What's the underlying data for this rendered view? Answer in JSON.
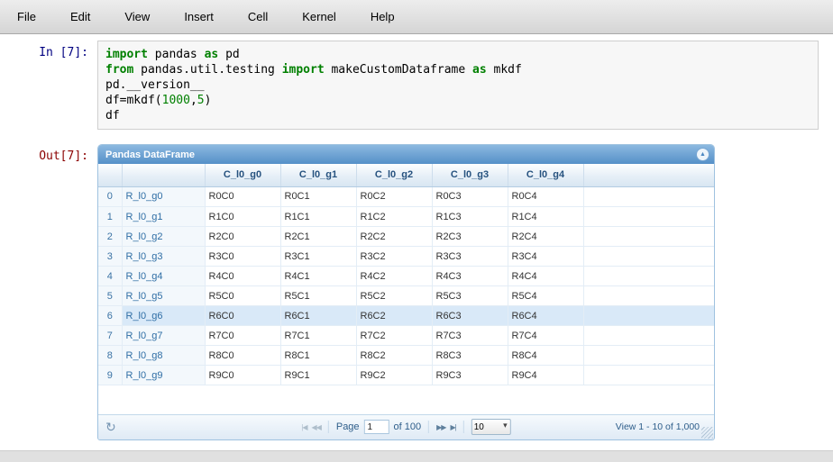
{
  "menu": {
    "items": [
      "File",
      "Edit",
      "View",
      "Insert",
      "Cell",
      "Kernel",
      "Help"
    ]
  },
  "icons": {
    "refresh": "↻",
    "collapse": "▲",
    "nav_first": "|◀",
    "nav_prev": "◀◀",
    "nav_next": "▶▶",
    "nav_last": "▶|"
  },
  "input_cell": {
    "prompt": "In [7]:",
    "code_lines": [
      [
        {
          "t": "kw",
          "v": "import"
        },
        {
          "t": "tx",
          "v": " pandas "
        },
        {
          "t": "kw",
          "v": "as"
        },
        {
          "t": "tx",
          "v": " pd"
        }
      ],
      [
        {
          "t": "kw",
          "v": "from"
        },
        {
          "t": "tx",
          "v": " pandas.util.testing "
        },
        {
          "t": "kw",
          "v": "import"
        },
        {
          "t": "tx",
          "v": " makeCustomDataframe "
        },
        {
          "t": "kw",
          "v": "as"
        },
        {
          "t": "tx",
          "v": " mkdf"
        }
      ],
      [
        {
          "t": "tx",
          "v": "pd.__version__"
        }
      ],
      [
        {
          "t": "tx",
          "v": "df=mkdf("
        },
        {
          "t": "num",
          "v": "1000"
        },
        {
          "t": "tx",
          "v": ","
        },
        {
          "t": "num",
          "v": "5"
        },
        {
          "t": "tx",
          "v": ")"
        }
      ],
      [
        {
          "t": "tx",
          "v": "df"
        }
      ]
    ]
  },
  "output_cell": {
    "prompt": "Out[7]:",
    "widget": {
      "title": "Pandas DataFrame",
      "columns": [
        "C_l0_g0",
        "C_l0_g1",
        "C_l0_g2",
        "C_l0_g3",
        "C_l0_g4"
      ],
      "rows": [
        {
          "n": "0",
          "index": "R_l0_g0",
          "cells": [
            "R0C0",
            "R0C1",
            "R0C2",
            "R0C3",
            "R0C4"
          ]
        },
        {
          "n": "1",
          "index": "R_l0_g1",
          "cells": [
            "R1C0",
            "R1C1",
            "R1C2",
            "R1C3",
            "R1C4"
          ]
        },
        {
          "n": "2",
          "index": "R_l0_g2",
          "cells": [
            "R2C0",
            "R2C1",
            "R2C2",
            "R2C3",
            "R2C4"
          ]
        },
        {
          "n": "3",
          "index": "R_l0_g3",
          "cells": [
            "R3C0",
            "R3C1",
            "R3C2",
            "R3C3",
            "R3C4"
          ]
        },
        {
          "n": "4",
          "index": "R_l0_g4",
          "cells": [
            "R4C0",
            "R4C1",
            "R4C2",
            "R4C3",
            "R4C4"
          ]
        },
        {
          "n": "5",
          "index": "R_l0_g5",
          "cells": [
            "R5C0",
            "R5C1",
            "R5C2",
            "R5C3",
            "R5C4"
          ]
        },
        {
          "n": "6",
          "index": "R_l0_g6",
          "cells": [
            "R6C0",
            "R6C1",
            "R6C2",
            "R6C3",
            "R6C4"
          ]
        },
        {
          "n": "7",
          "index": "R_l0_g7",
          "cells": [
            "R7C0",
            "R7C1",
            "R7C2",
            "R7C3",
            "R7C4"
          ]
        },
        {
          "n": "8",
          "index": "R_l0_g8",
          "cells": [
            "R8C0",
            "R8C1",
            "R8C2",
            "R8C3",
            "R8C4"
          ]
        },
        {
          "n": "9",
          "index": "R_l0_g9",
          "cells": [
            "R9C0",
            "R9C1",
            "R9C2",
            "R9C3",
            "R9C4"
          ]
        }
      ],
      "selected_row_index": 6,
      "pager": {
        "page_label": "Page",
        "page_value": "1",
        "total_pages": "of 100",
        "page_size": "10",
        "status": "View 1 - 10 of 1,000"
      },
      "colors": {
        "titlebar_top": "#8cb9e0",
        "titlebar_bottom": "#5590c8",
        "selected_row": "#d9e9f8",
        "header_text": "#26527f"
      }
    }
  }
}
